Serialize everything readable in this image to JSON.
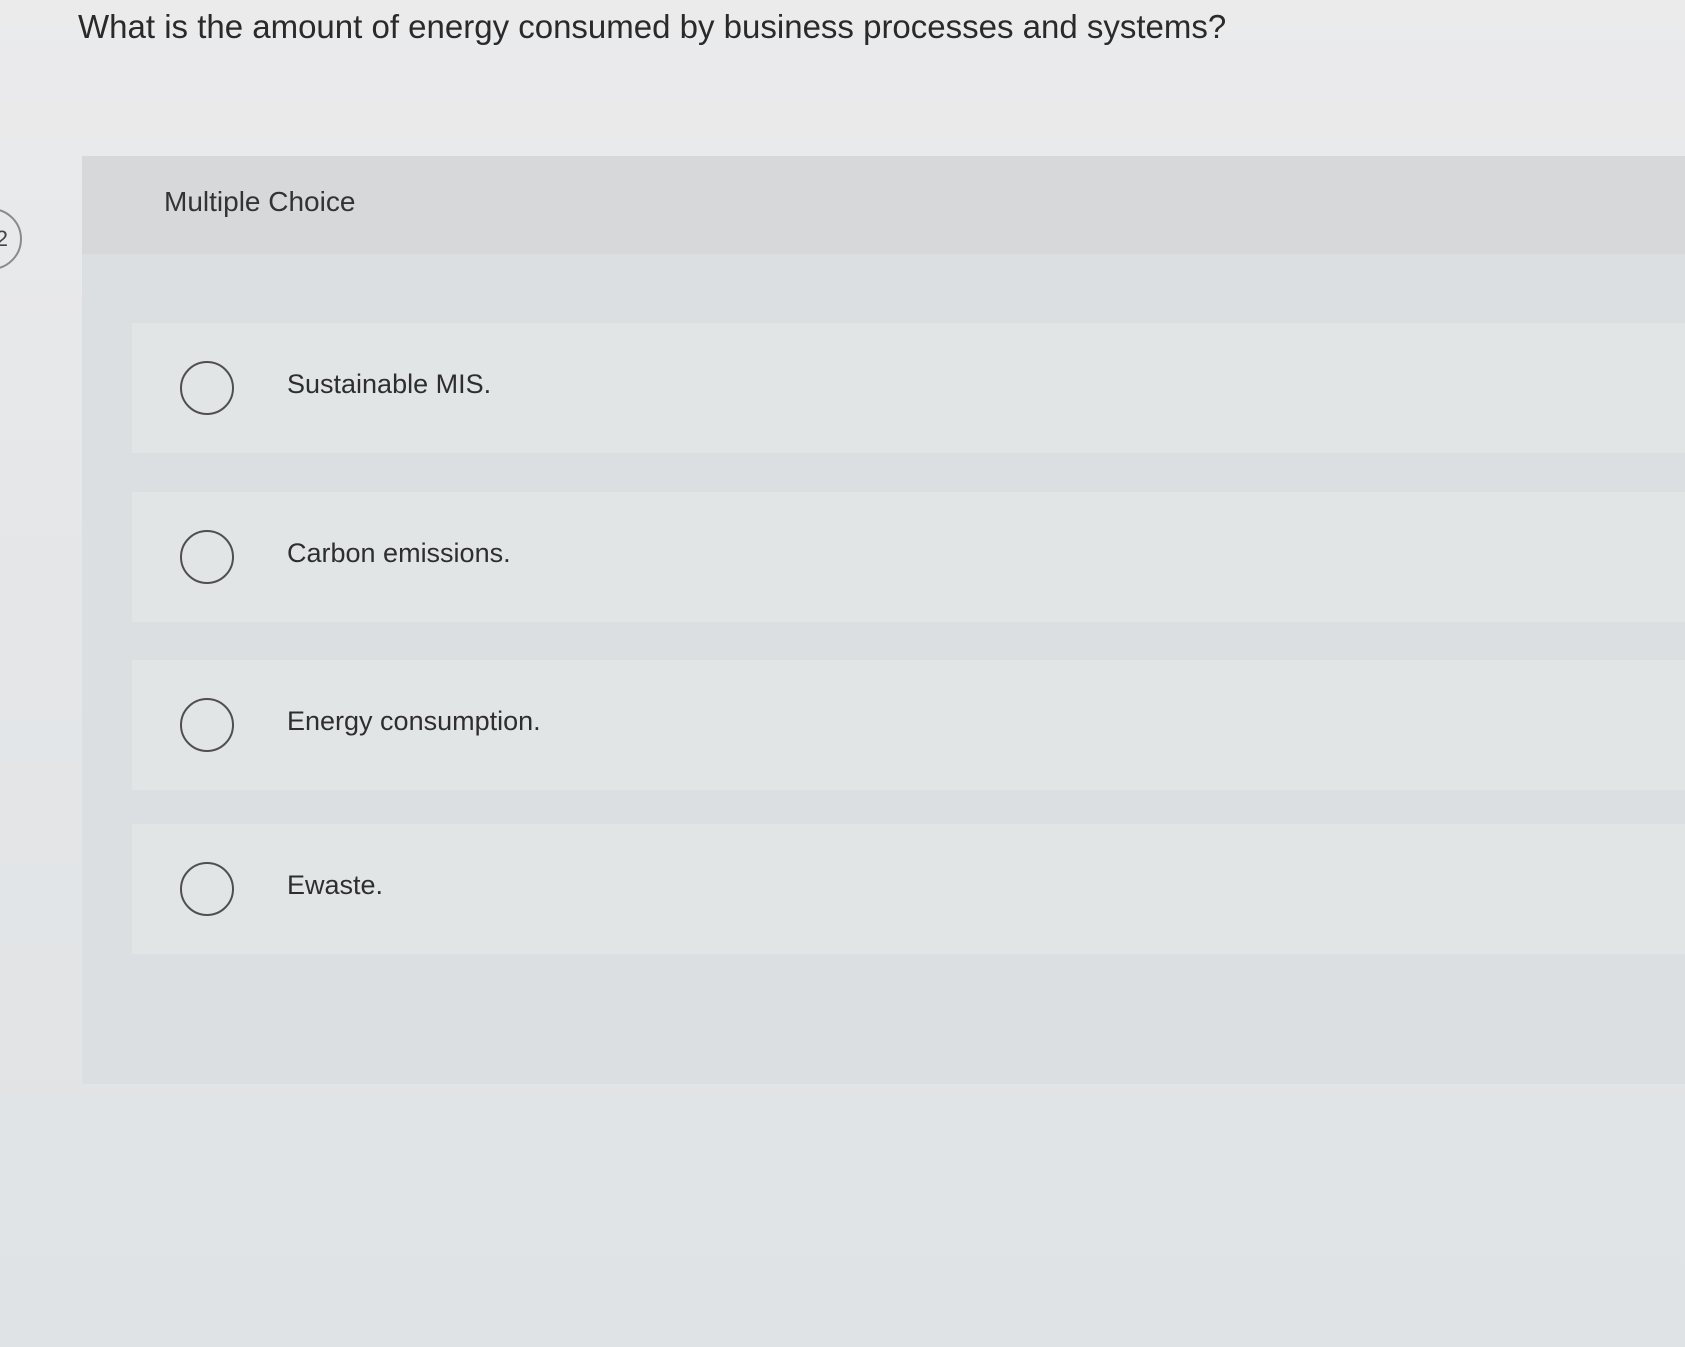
{
  "question": {
    "number": "2",
    "text": "What is the amount of energy consumed by business processes and systems?"
  },
  "answer_panel": {
    "label": "Multiple Choice",
    "options": [
      {
        "label": "Sustainable MIS.",
        "selected": false
      },
      {
        "label": "Carbon emissions.",
        "selected": false
      },
      {
        "label": "Energy consumption.",
        "selected": false
      },
      {
        "label": "Ewaste.",
        "selected": false
      }
    ]
  },
  "colors": {
    "page_background": "#e6e7e9",
    "panel_background": "#dcdfe1",
    "option_background": "#e2e5e6",
    "radio_border": "#4f4f4f"
  }
}
